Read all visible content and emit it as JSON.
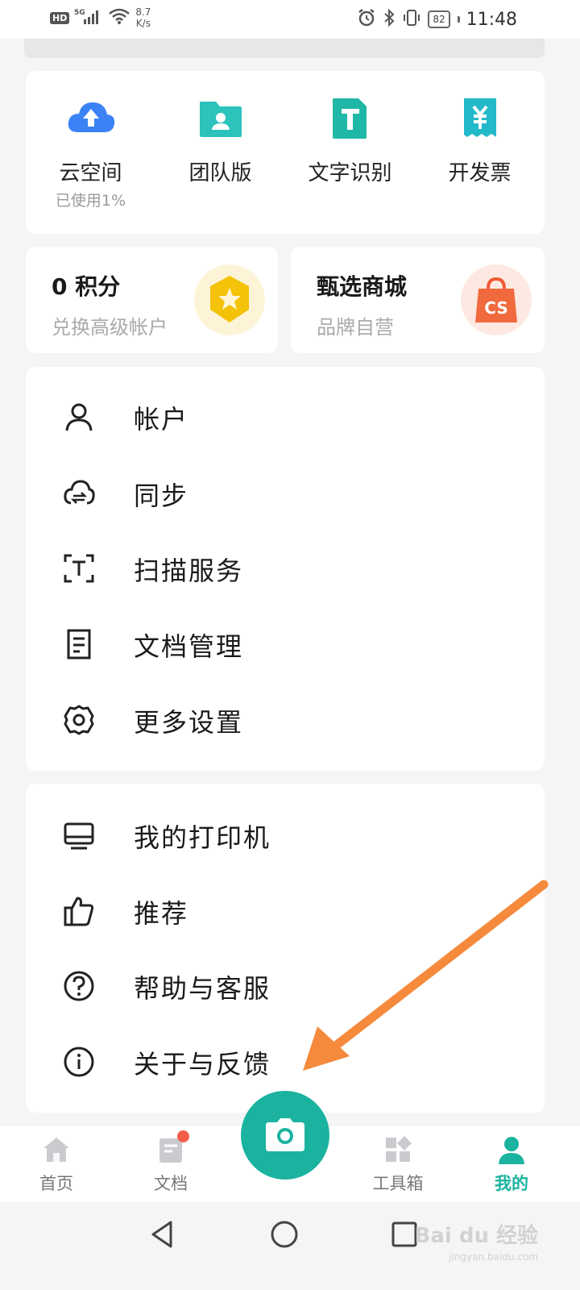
{
  "status_bar": {
    "hd": "HD",
    "network": "5G",
    "speed_value": "8.7",
    "speed_unit": "K/s",
    "battery": "82",
    "time": "11:48"
  },
  "quick_tools": [
    {
      "label": "云空间",
      "sub": "已使用1%",
      "icon": "cloud-upload-icon",
      "color": "#3b82f6"
    },
    {
      "label": "团队版",
      "icon": "team-folder-icon",
      "color": "#2cc3bd"
    },
    {
      "label": "文字识别",
      "icon": "text-recognition-icon",
      "color": "#1fb8a6"
    },
    {
      "label": "开发票",
      "icon": "invoice-icon",
      "color": "#22b9c9"
    }
  ],
  "promos": [
    {
      "title": "0 积分",
      "sub": "兑换高级帐户",
      "icon": "points-star-icon"
    },
    {
      "title": "甄选商城",
      "sub": "品牌自营",
      "icon": "shopping-bag-icon"
    }
  ],
  "menu_group_1": [
    {
      "label": "帐户",
      "icon": "user-icon"
    },
    {
      "label": "同步",
      "icon": "cloud-sync-icon"
    },
    {
      "label": "扫描服务",
      "icon": "scan-text-icon"
    },
    {
      "label": "文档管理",
      "icon": "document-icon"
    },
    {
      "label": "更多设置",
      "icon": "gear-icon"
    }
  ],
  "menu_group_2": [
    {
      "label": "我的打印机",
      "icon": "printer-icon"
    },
    {
      "label": "推荐",
      "icon": "thumbs-up-icon"
    },
    {
      "label": "帮助与客服",
      "icon": "help-icon"
    },
    {
      "label": "关于与反馈",
      "icon": "info-icon"
    }
  ],
  "bottom_nav": [
    {
      "label": "首页",
      "icon": "home-icon",
      "active": false
    },
    {
      "label": "文档",
      "icon": "docs-icon",
      "active": false,
      "badge": true
    },
    {
      "label": "工具箱",
      "icon": "toolbox-icon",
      "active": false
    },
    {
      "label": "我的",
      "icon": "profile-icon",
      "active": true
    }
  ],
  "colors": {
    "accent": "#1bb3a0",
    "arrow": "#f58a3c",
    "badge_dot": "#f25c4a"
  },
  "watermark": {
    "text": "Bai du 经验",
    "sub": "jingyan.baidu.com"
  }
}
